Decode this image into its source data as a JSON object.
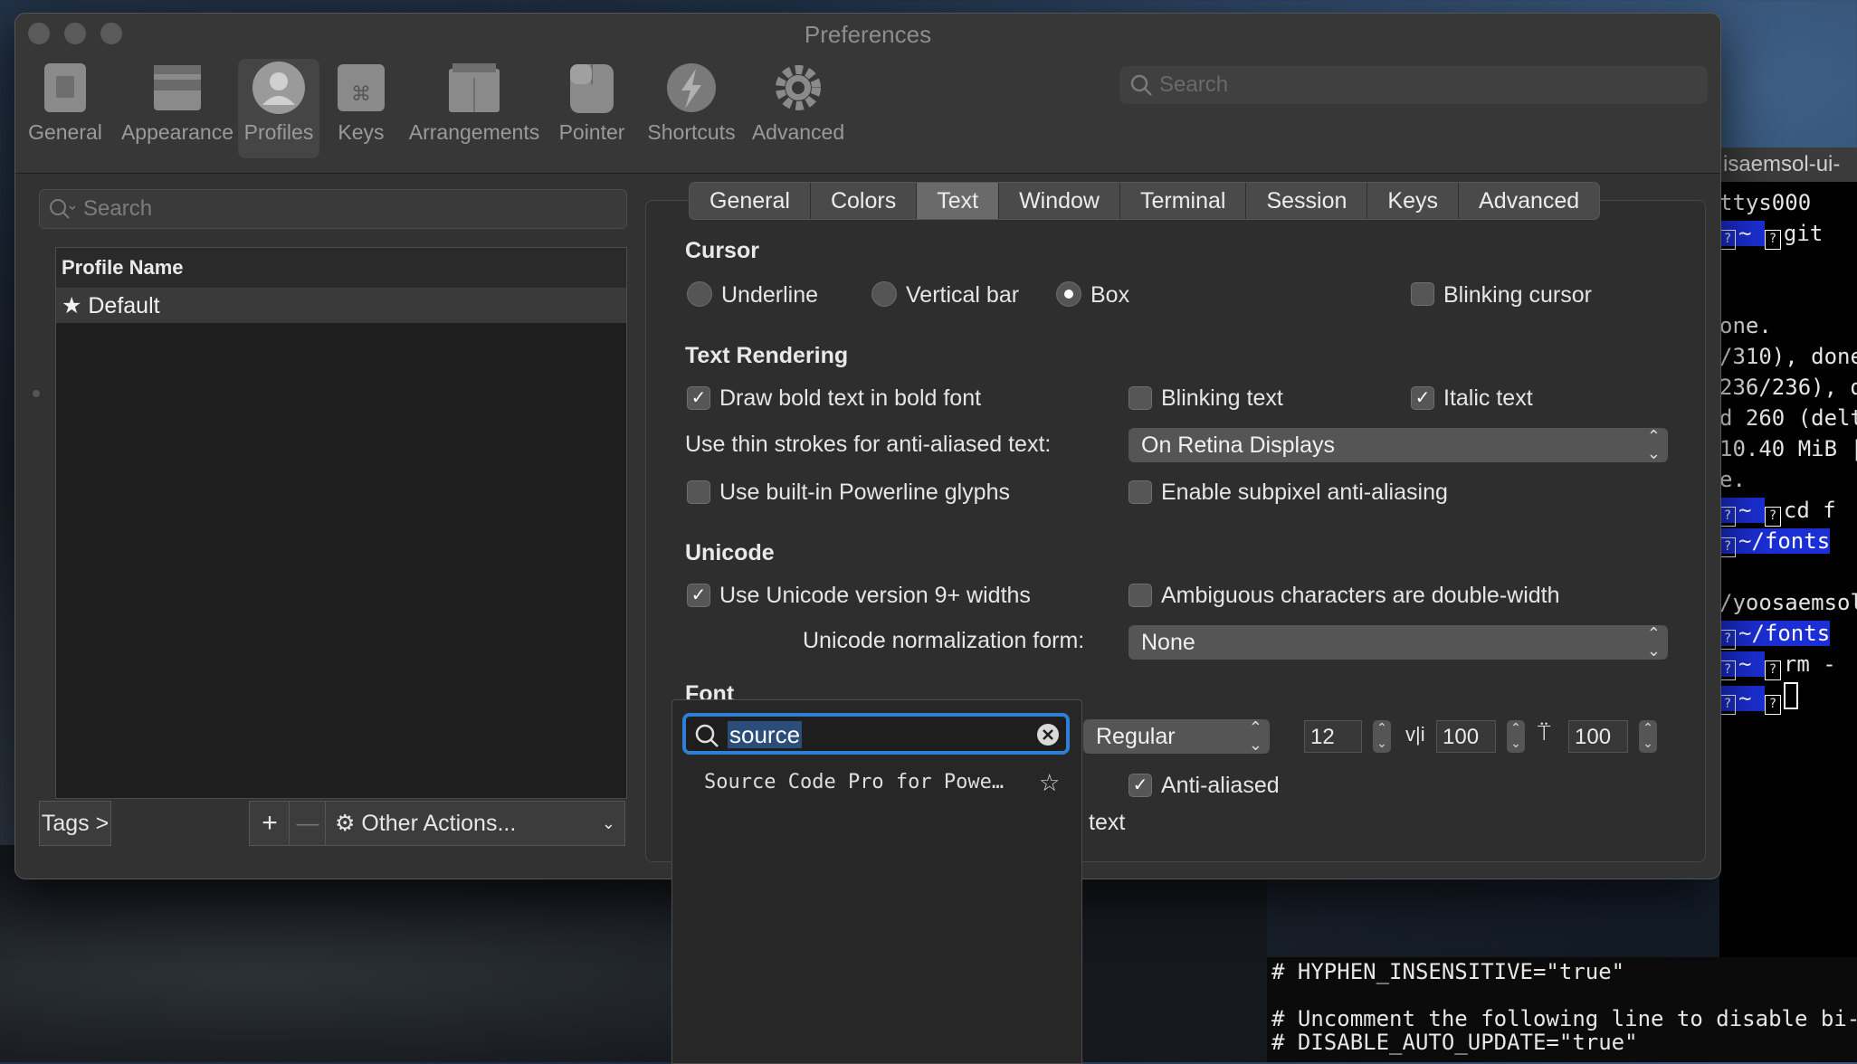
{
  "window": {
    "title": "Preferences"
  },
  "toolbar": {
    "items": [
      {
        "label": "General",
        "icon": "general-icon"
      },
      {
        "label": "Appearance",
        "icon": "appearance-icon"
      },
      {
        "label": "Profiles",
        "icon": "profiles-icon"
      },
      {
        "label": "Keys",
        "icon": "keys-icon"
      },
      {
        "label": "Arrangements",
        "icon": "arrangements-icon"
      },
      {
        "label": "Pointer",
        "icon": "pointer-icon"
      },
      {
        "label": "Shortcuts",
        "icon": "shortcuts-icon"
      },
      {
        "label": "Advanced",
        "icon": "advanced-icon"
      }
    ],
    "selected": "Profiles",
    "search_placeholder": "Search"
  },
  "profiles": {
    "search_placeholder": "Search",
    "column_header": "Profile Name",
    "rows": [
      {
        "name": "Default",
        "starred": true
      }
    ],
    "tags_button": "Tags >",
    "add_button": "+",
    "remove_button": "—",
    "other_actions": "Other Actions..."
  },
  "tabs": {
    "items": [
      "General",
      "Colors",
      "Text",
      "Window",
      "Terminal",
      "Session",
      "Keys",
      "Advanced"
    ],
    "selected": "Text"
  },
  "cursor": {
    "heading": "Cursor",
    "options": [
      "Underline",
      "Vertical bar",
      "Box"
    ],
    "selected": "Box",
    "blinking_label": "Blinking cursor",
    "blinking": false
  },
  "text_rendering": {
    "heading": "Text Rendering",
    "bold_label": "Draw bold text in bold font",
    "bold": true,
    "blinking_text_label": "Blinking text",
    "blinking_text": false,
    "italic_label": "Italic text",
    "italic": true,
    "thin_strokes_label": "Use thin strokes for anti-aliased text:",
    "thin_strokes_value": "On Retina Displays",
    "powerline_label": "Use built-in Powerline glyphs",
    "powerline": false,
    "subpixel_label": "Enable subpixel anti-aliasing",
    "subpixel": false
  },
  "unicode": {
    "heading": "Unicode",
    "v9_label": "Use Unicode version 9+ widths",
    "v9": true,
    "ambiguous_label": "Ambiguous characters are double-width",
    "ambiguous": false,
    "normalization_label": "Unicode normalization form:",
    "normalization_value": "None"
  },
  "font": {
    "heading": "Font",
    "search_value": "source",
    "result": "Source Code Pro for Powe…",
    "style": "Regular",
    "size": "12",
    "vertical_spacing": "100",
    "horizontal_spacing": "100",
    "anti_aliased_label": "Anti-aliased",
    "anti_aliased": true,
    "text_fragment": "text"
  },
  "terminal": {
    "title": "isaemsol-ui-",
    "lines": [
      "ttys000",
      "git",
      "one.",
      "/310), done",
      "236/236), d",
      "d 260 (delt",
      "10.40 MiB |",
      "e.",
      "cd f",
      "~/fonts",
      "/yoosaemsol",
      "~/fonts",
      "rm -"
    ],
    "bottom_lines": [
      "# HYPHEN_INSENSITIVE=\"true\"",
      "# Uncomment the following line to disable bi-w",
      "# DISABLE_AUTO_UPDATE=\"true\""
    ]
  },
  "colors": {
    "accent": "#2f7fd6",
    "terminal_highlight": "#1b2fd6"
  }
}
